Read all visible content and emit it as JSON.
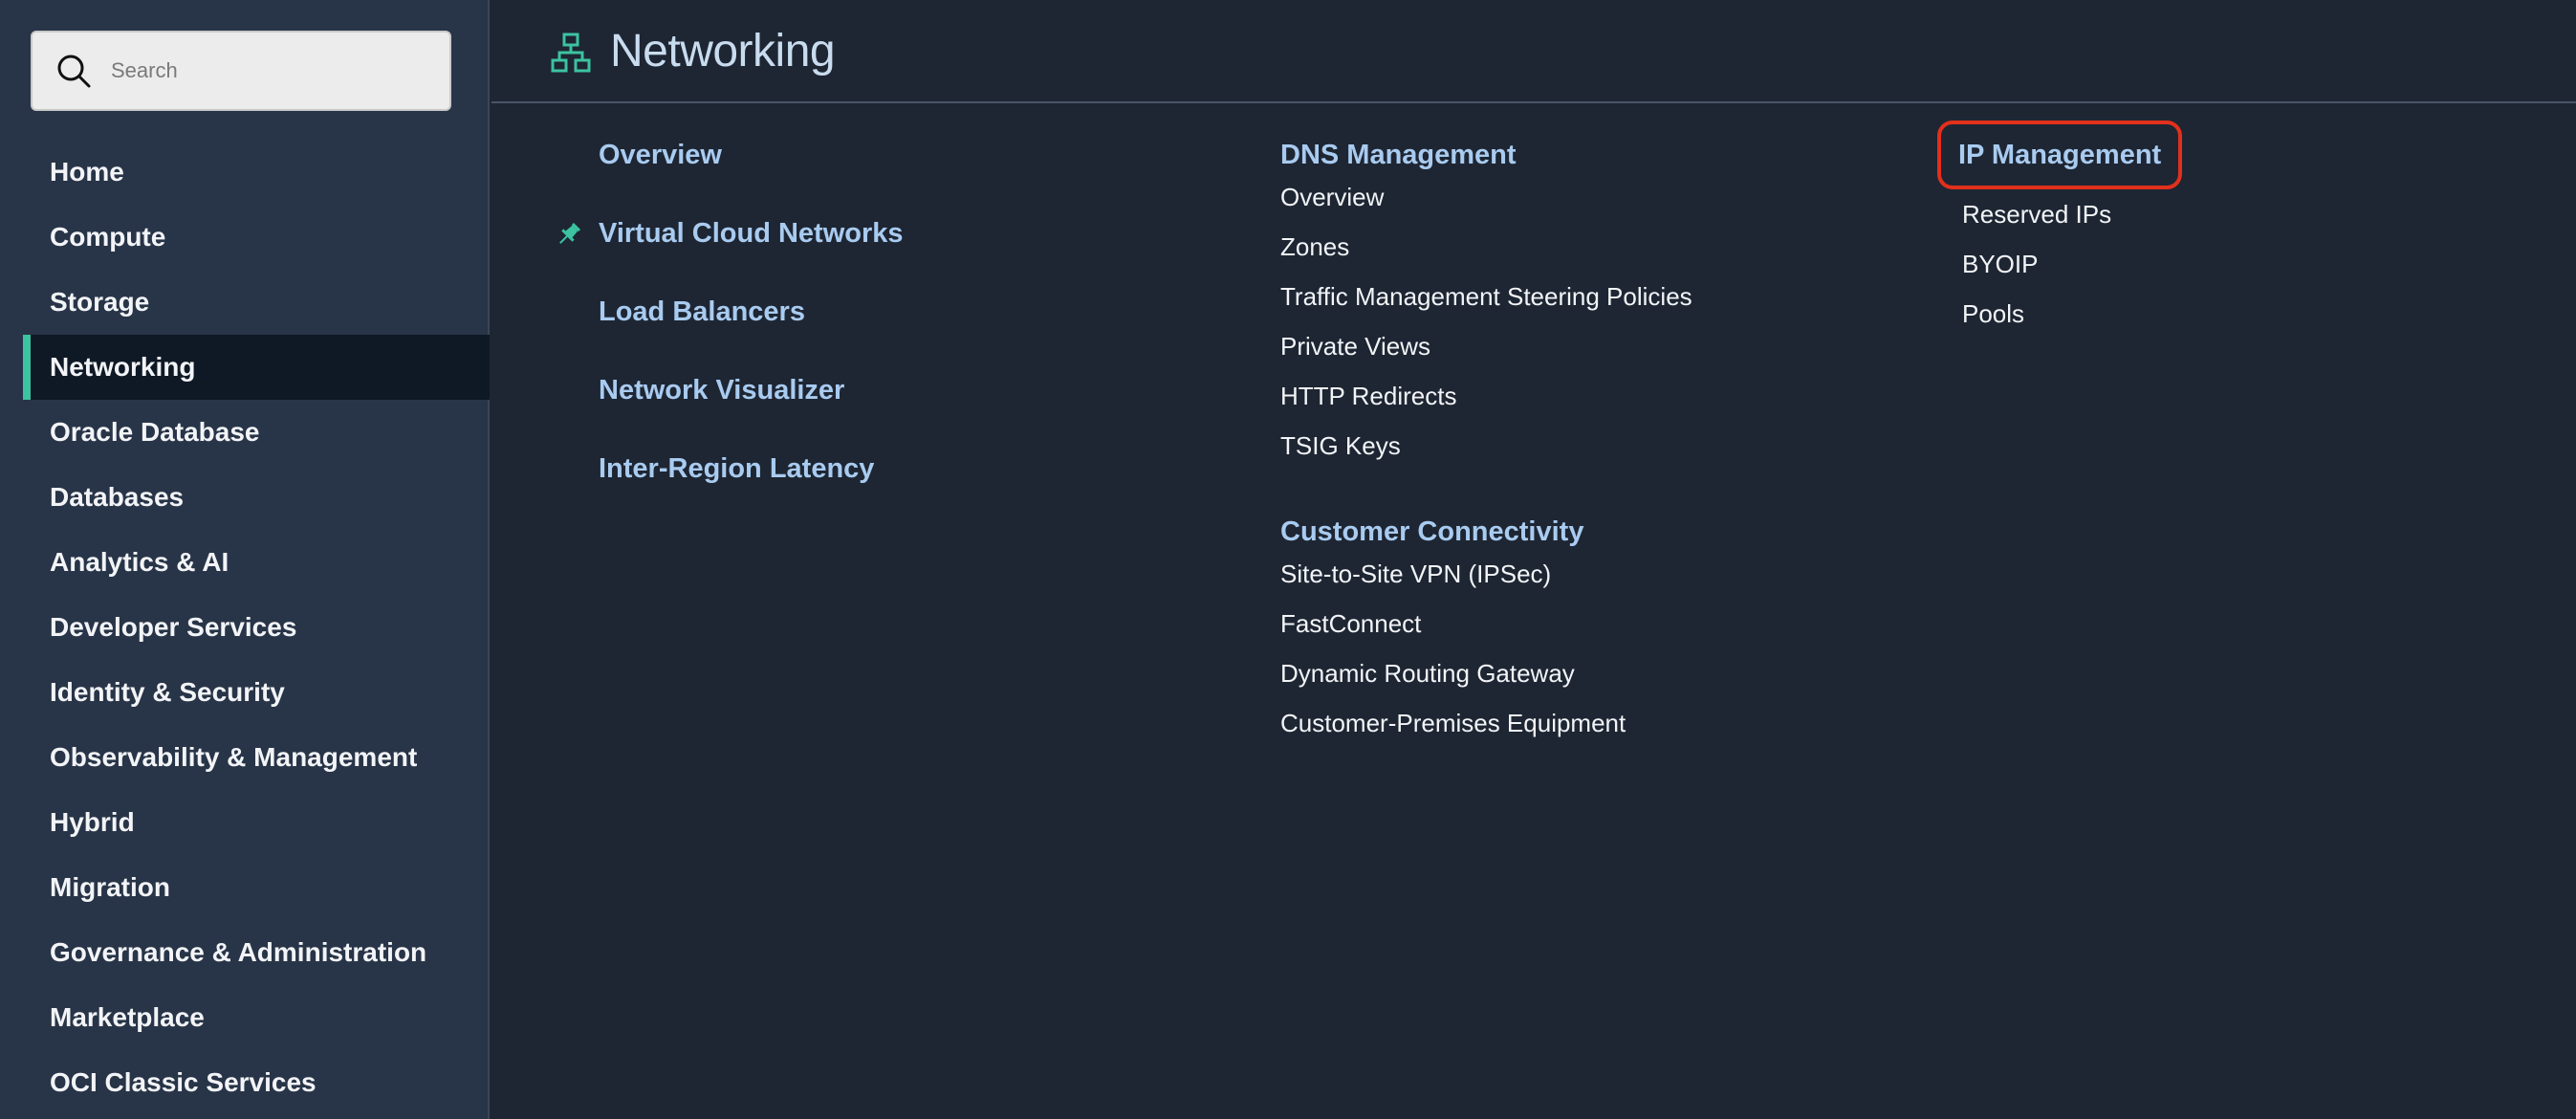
{
  "search": {
    "placeholder": "Search"
  },
  "sidebar": {
    "items": [
      {
        "label": "Home"
      },
      {
        "label": "Compute"
      },
      {
        "label": "Storage"
      },
      {
        "label": "Networking"
      },
      {
        "label": "Oracle Database"
      },
      {
        "label": "Databases"
      },
      {
        "label": "Analytics & AI"
      },
      {
        "label": "Developer Services"
      },
      {
        "label": "Identity & Security"
      },
      {
        "label": "Observability & Management"
      },
      {
        "label": "Hybrid"
      },
      {
        "label": "Migration"
      },
      {
        "label": "Governance & Administration"
      },
      {
        "label": "Marketplace"
      },
      {
        "label": "OCI Classic Services"
      }
    ],
    "active": "Networking"
  },
  "header": {
    "title": "Networking",
    "icon": "network-icon"
  },
  "links": [
    {
      "label": "Overview"
    },
    {
      "label": "Virtual Cloud Networks",
      "pinned": true
    },
    {
      "label": "Load Balancers"
    },
    {
      "label": "Network Visualizer"
    },
    {
      "label": "Inter-Region Latency"
    }
  ],
  "dns": {
    "title": "DNS Management",
    "items": [
      "Overview",
      "Zones",
      "Traffic Management Steering Policies",
      "Private Views",
      "HTTP Redirects",
      "TSIG Keys"
    ]
  },
  "connectivity": {
    "title": "Customer Connectivity",
    "items": [
      "Site-to-Site VPN (IPSec)",
      "FastConnect",
      "Dynamic Routing Gateway",
      "Customer-Premises Equipment"
    ]
  },
  "ip": {
    "title": "IP Management",
    "items": [
      "Reserved IPs",
      "BYOIP",
      "Pools"
    ]
  },
  "colors": {
    "accent": "#3cc3a0",
    "link": "#a9cbf0",
    "highlight": "#e2301c",
    "background": "#1e2633",
    "sidebar": "#283447"
  }
}
